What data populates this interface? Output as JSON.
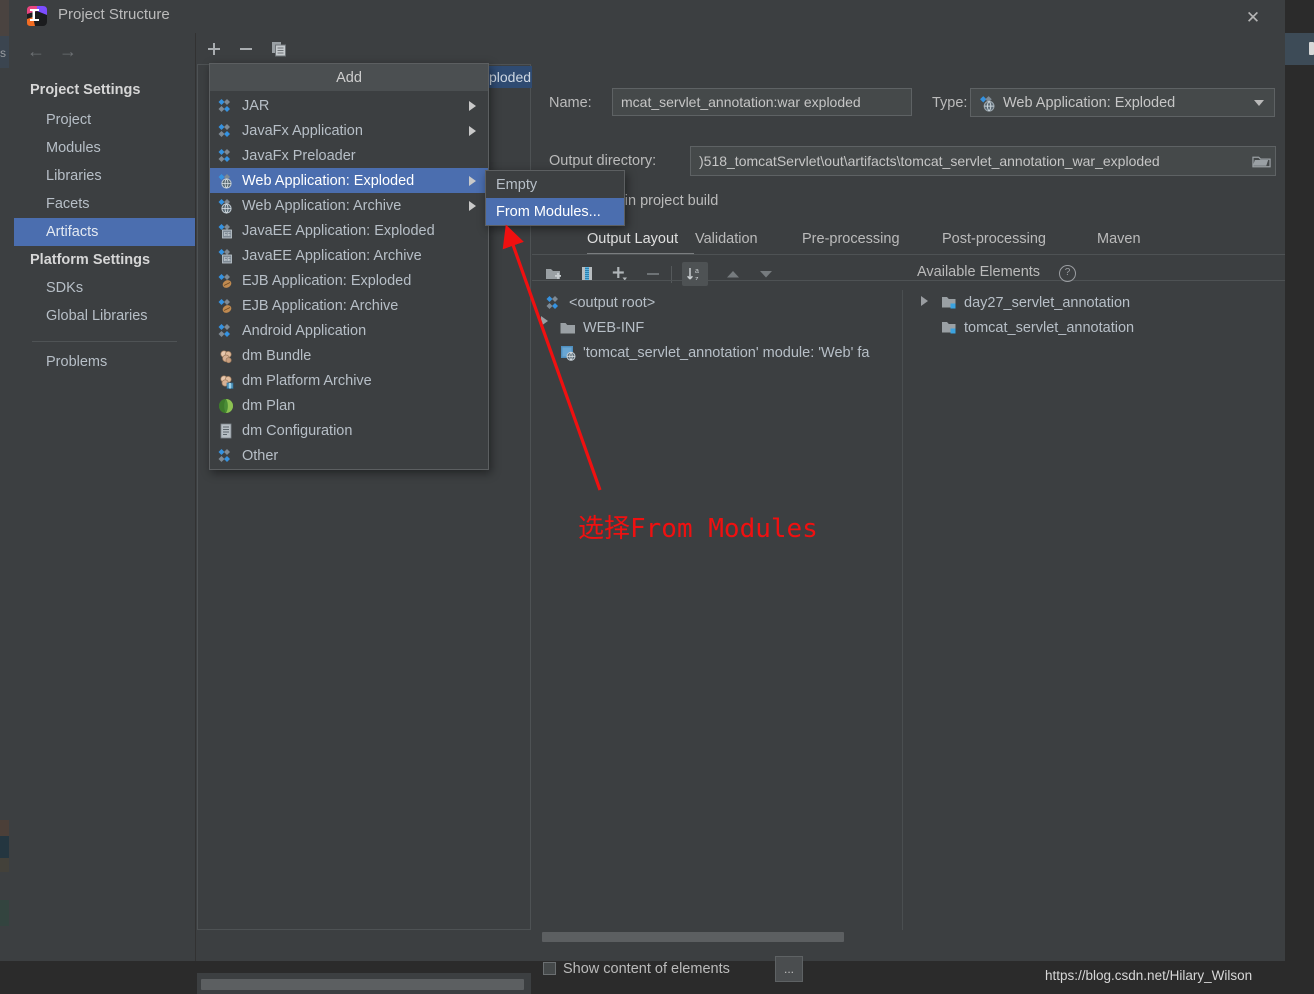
{
  "window": {
    "title": "Project Structure",
    "close_label": "✕",
    "app_icon": "intellij-idea-icon"
  },
  "sidebar": {
    "nav": {
      "back": "←",
      "forward": "→"
    },
    "groups": [
      {
        "label": "Project Settings",
        "items": [
          {
            "label": "Project",
            "selected": false
          },
          {
            "label": "Modules",
            "selected": false
          },
          {
            "label": "Libraries",
            "selected": false
          },
          {
            "label": "Facets",
            "selected": false
          },
          {
            "label": "Artifacts",
            "selected": true
          }
        ]
      },
      {
        "label": "Platform Settings",
        "items": [
          {
            "label": "SDKs",
            "selected": false
          },
          {
            "label": "Global Libraries",
            "selected": false
          }
        ]
      }
    ],
    "problems": "Problems"
  },
  "artifacts_toolbar": {
    "add": "+",
    "remove": "−",
    "copy": "copy-icon"
  },
  "popup_menu": {
    "header": "Add",
    "items": [
      {
        "label": "JAR",
        "icon": "artifact-icon",
        "submenu": true,
        "selected": false
      },
      {
        "label": "JavaFx Application",
        "icon": "artifact-icon",
        "submenu": true,
        "selected": false
      },
      {
        "label": "JavaFx Preloader",
        "icon": "artifact-icon",
        "submenu": false,
        "selected": false
      },
      {
        "label": "Web Application: Exploded",
        "icon": "web-artifact-icon",
        "submenu": true,
        "selected": true
      },
      {
        "label": "Web Application: Archive",
        "icon": "web-artifact-icon",
        "submenu": true,
        "selected": false
      },
      {
        "label": "JavaEE Application: Exploded",
        "icon": "javaee-artifact-icon",
        "submenu": false,
        "selected": false
      },
      {
        "label": "JavaEE Application: Archive",
        "icon": "javaee-artifact-icon",
        "submenu": false,
        "selected": false
      },
      {
        "label": "EJB Application: Exploded",
        "icon": "ejb-artifact-icon",
        "submenu": false,
        "selected": false
      },
      {
        "label": "EJB Application: Archive",
        "icon": "ejb-artifact-icon",
        "submenu": false,
        "selected": false
      },
      {
        "label": "Android Application",
        "icon": "artifact-icon",
        "submenu": false,
        "selected": false
      },
      {
        "label": "dm Bundle",
        "icon": "dm-bundle-icon",
        "submenu": false,
        "selected": false
      },
      {
        "label": "dm Platform Archive",
        "icon": "dm-platform-icon",
        "submenu": false,
        "selected": false
      },
      {
        "label": "dm Plan",
        "icon": "dm-plan-icon",
        "submenu": false,
        "selected": false
      },
      {
        "label": "dm Configuration",
        "icon": "dm-config-icon",
        "submenu": false,
        "selected": false
      },
      {
        "label": "Other",
        "icon": "artifact-icon",
        "submenu": false,
        "selected": false
      }
    ]
  },
  "submenu": {
    "items": [
      {
        "label": "Empty",
        "selected": false
      },
      {
        "label": "From Modules...",
        "selected": true
      }
    ]
  },
  "hidden_artifact_label": "ploded",
  "form": {
    "name_label": "Name:",
    "name_value": "mcat_servlet_annotation:war exploded",
    "type_label": "Type:",
    "type_value": "Web Application: Exploded",
    "type_icon": "web-artifact-icon",
    "output_label": "Output directory:",
    "output_value": ")518_tomcatServlet\\out\\artifacts\\tomcat_servlet_annotation_war_exploded",
    "browse_icon": "folder-icon",
    "include_in_build_label": "Include in project build",
    "include_in_build_checked": false
  },
  "tabs": [
    {
      "label": "Output Layout",
      "active": true
    },
    {
      "label": "Validation",
      "active": false
    },
    {
      "label": "Pre-processing",
      "active": false
    },
    {
      "label": "Post-processing",
      "active": false
    },
    {
      "label": "Maven",
      "active": false
    }
  ],
  "layout_toolbar": {
    "buttons": [
      {
        "name": "add-directory-icon",
        "pressed": false
      },
      {
        "name": "add-archive-icon",
        "pressed": false
      },
      {
        "name": "add-copy-icon",
        "pressed": false
      },
      {
        "name": "remove-icon",
        "pressed": false
      },
      {
        "name": "sort-alphabetically-icon",
        "pressed": true
      },
      {
        "name": "move-up-icon",
        "pressed": false
      },
      {
        "name": "move-down-icon",
        "pressed": false
      }
    ]
  },
  "output_tree": [
    {
      "label": "<output root>",
      "icon": "artifact-icon",
      "indent": 0,
      "toggle": false
    },
    {
      "label": "WEB-INF",
      "icon": "folder-icon",
      "indent": 1,
      "toggle": true
    },
    {
      "label": "'tomcat_servlet_annotation' module: 'Web' fa",
      "icon": "web-facet-icon",
      "indent": 1,
      "toggle": false
    }
  ],
  "available_elements": {
    "header": "Available Elements",
    "help_icon": "help-icon",
    "items": [
      {
        "label": "day27_servlet_annotation",
        "icon": "module-icon",
        "toggle": true
      },
      {
        "label": "tomcat_servlet_annotation",
        "icon": "module-icon",
        "toggle": false
      }
    ]
  },
  "footer": {
    "show_content_label": "Show content of elements",
    "show_content_checked": false,
    "dots_button": "...",
    "watermark": "https://blog.csdn.net/Hilary_Wilson"
  },
  "annotation": {
    "text": "选择From Modules",
    "color": "#f01010"
  },
  "background": {
    "left_letter": "s",
    "bug_icon": "debug-bug-icon"
  }
}
